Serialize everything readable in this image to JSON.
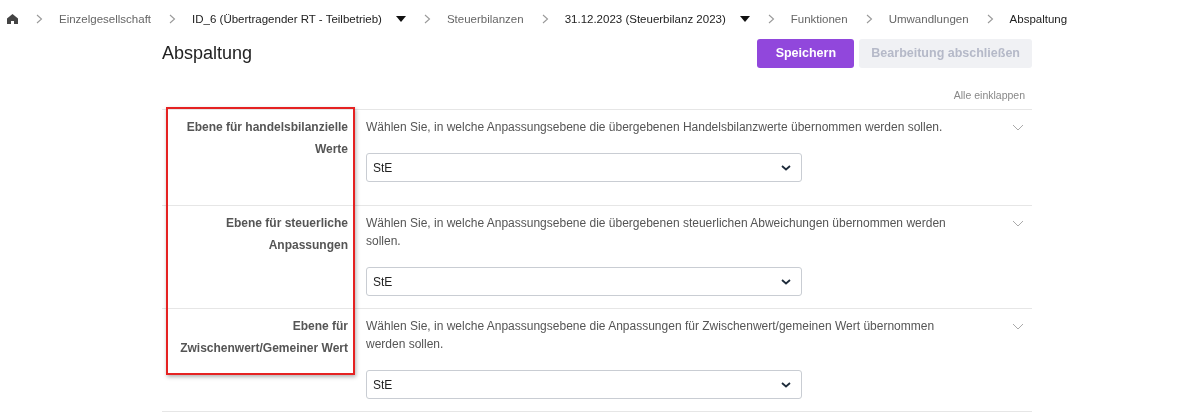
{
  "breadcrumb": [
    {
      "label": "Einzelgesellschaft",
      "kind": "link"
    },
    {
      "label": "ID_6 (Übertragender RT - Teilbetrieb)",
      "kind": "dropdown"
    },
    {
      "label": "Steuerbilanzen",
      "kind": "link"
    },
    {
      "label": "31.12.2023 (Steuerbilanz 2023)",
      "kind": "dropdown"
    },
    {
      "label": "Funktionen",
      "kind": "link"
    },
    {
      "label": "Umwandlungen",
      "kind": "link"
    },
    {
      "label": "Abspaltung",
      "kind": "current"
    }
  ],
  "title": "Abspaltung",
  "buttons": [
    {
      "label": "Speichern",
      "disabled": false
    },
    {
      "label": "Bearbeitung abschließen",
      "disabled": true
    }
  ],
  "collapse_all": "Alle einklappen",
  "sections": [
    {
      "label": "Ebene für handelsbilanzielle Werte",
      "description": "Wählen Sie, in welche Anpassungsebene die übergebenen Handelsbilanzwerte übernommen werden sollen.",
      "value": "StE",
      "expanded": true
    },
    {
      "label": "Ebene für steuerliche Anpassungen",
      "description": "Wählen Sie, in welche Anpassungsebene die übergebenen steuerlichen Abweichungen übernommen werden sollen.",
      "value": "StE",
      "expanded": true
    },
    {
      "label": "Ebene für Zwischenwert/Gemeiner Wert",
      "description": "Wählen Sie, in welche Anpassungsebene die Anpassungen für Zwischenwert/gemeinen Wert übernommen werden sollen.",
      "value": "StE",
      "expanded": true
    }
  ]
}
